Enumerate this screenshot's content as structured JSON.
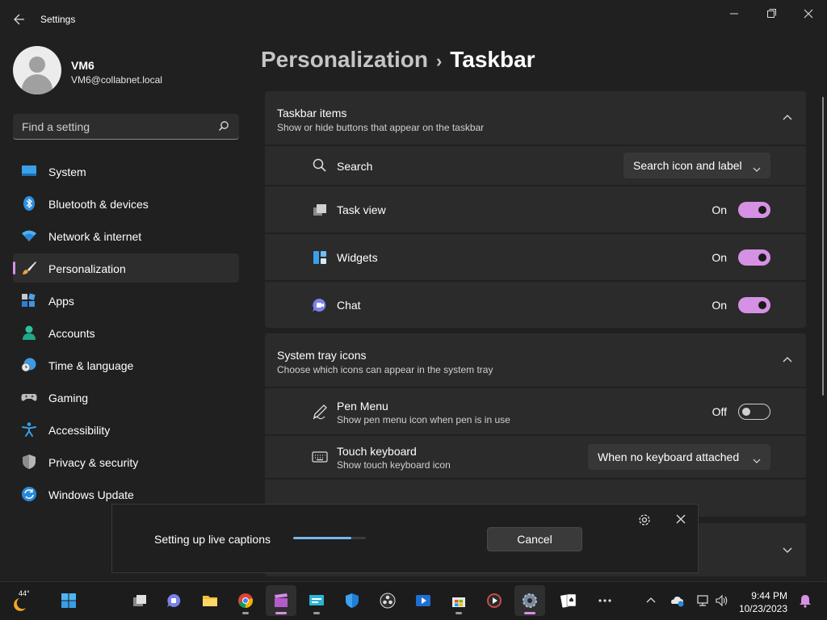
{
  "window": {
    "title": "Settings",
    "back_icon": "back-arrow-icon",
    "minimize_icon": "minimize-icon",
    "maximize_icon": "maximize-icon",
    "close_icon": "close-icon"
  },
  "profile": {
    "name": "VM6",
    "email": "VM6@collabnet.local"
  },
  "search": {
    "placeholder": "Find a setting",
    "value": ""
  },
  "sidebar": {
    "active": "Personalization",
    "items": [
      {
        "label": "System",
        "icon": "system-icon"
      },
      {
        "label": "Bluetooth & devices",
        "icon": "bluetooth-icon"
      },
      {
        "label": "Network & internet",
        "icon": "wifi-icon"
      },
      {
        "label": "Personalization",
        "icon": "brush-icon"
      },
      {
        "label": "Apps",
        "icon": "apps-icon"
      },
      {
        "label": "Accounts",
        "icon": "accounts-icon"
      },
      {
        "label": "Time & language",
        "icon": "globe-clock-icon"
      },
      {
        "label": "Gaming",
        "icon": "gamepad-icon"
      },
      {
        "label": "Accessibility",
        "icon": "accessibility-icon"
      },
      {
        "label": "Privacy & security",
        "icon": "shield-icon"
      },
      {
        "label": "Windows Update",
        "icon": "update-icon"
      }
    ]
  },
  "breadcrumb": {
    "parent": "Personalization",
    "separator": "›",
    "current": "Taskbar"
  },
  "sections": {
    "taskbar_items": {
      "title": "Taskbar items",
      "subtitle": "Show or hide buttons that appear on the taskbar",
      "expanded": true,
      "rows": [
        {
          "label": "Search",
          "icon": "search-icon",
          "control": "dropdown",
          "value": "Search icon and label"
        },
        {
          "label": "Task view",
          "icon": "task-view-icon",
          "control": "toggle",
          "status": "On",
          "on": true
        },
        {
          "label": "Widgets",
          "icon": "widgets-icon",
          "control": "toggle",
          "status": "On",
          "on": true
        },
        {
          "label": "Chat",
          "icon": "chat-icon",
          "control": "toggle",
          "status": "On",
          "on": true
        }
      ]
    },
    "system_tray": {
      "title": "System tray icons",
      "subtitle": "Choose which icons can appear in the system tray",
      "expanded": true,
      "rows": [
        {
          "label": "Pen Menu",
          "sub": "Show pen menu icon when pen is in use",
          "icon": "pen-icon",
          "control": "toggle",
          "status": "Off",
          "on": false
        },
        {
          "label": "Touch keyboard",
          "sub": "Show touch keyboard icon",
          "icon": "keyboard-icon",
          "control": "dropdown",
          "value": "When no keyboard attached"
        }
      ]
    }
  },
  "live_captions": {
    "text": "Setting up live captions",
    "progress": 0.8,
    "cancel_label": "Cancel",
    "settings_icon": "gear-icon",
    "close_icon": "close-icon"
  },
  "taskbar": {
    "weather_temp": "44°",
    "apps": [
      "start-icon",
      "task-view-icon",
      "chat-icon",
      "file-explorer-icon",
      "chrome-icon",
      "clapperboard-icon",
      "remote-desktop-icon",
      "defender-shield-icon",
      "obs-icon",
      "video-editor-icon",
      "store-icon",
      "media-player-icon",
      "settings-icon",
      "solitaire-icon",
      "more-icon"
    ],
    "active_app": "settings-icon",
    "tray": [
      "chevron-up-icon",
      "onedrive-icon",
      "network-icon",
      "volume-icon"
    ],
    "time": "9:44 PM",
    "date": "10/23/2023",
    "notification_icon": "bell-icon"
  },
  "colors": {
    "accent": "#d591e3",
    "background": "#202020",
    "card": "#2b2b2b",
    "progress": "#76b9ed"
  }
}
